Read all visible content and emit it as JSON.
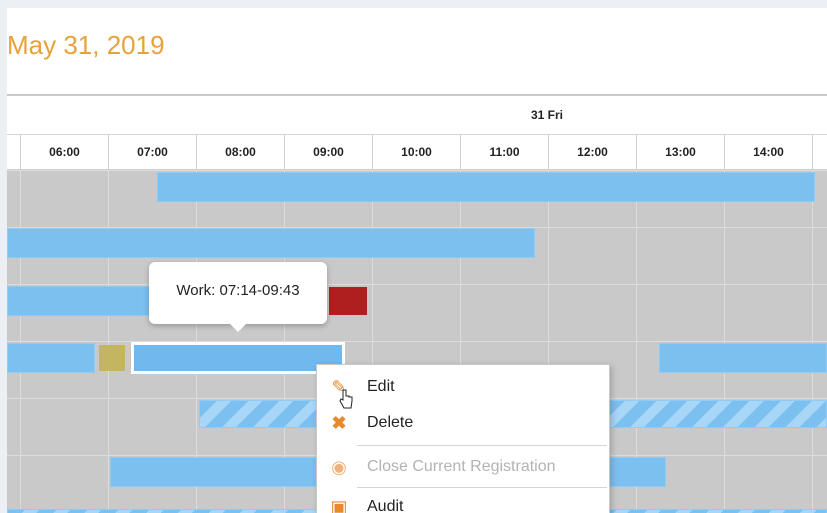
{
  "header": {
    "date_title": "May 31, 2019",
    "day_label": "31 Fri"
  },
  "hours": [
    "06:00",
    "07:00",
    "08:00",
    "09:00",
    "10:00",
    "11:00",
    "12:00",
    "13:00",
    "14:00"
  ],
  "tooltip": {
    "text": "Work: 07:14-09:43"
  },
  "context_menu": {
    "items": [
      {
        "label": "Edit",
        "icon": "edit-icon",
        "disabled": false
      },
      {
        "label": "Delete",
        "icon": "delete-icon",
        "disabled": false
      },
      {
        "label": "Close Current Registration",
        "icon": "close-registration-icon",
        "disabled": true
      },
      {
        "label": "Audit",
        "icon": "audit-icon",
        "disabled": false
      }
    ]
  },
  "colors": {
    "accent": "#e8a23a",
    "bar": "#7cc0f0",
    "alert_block": "#b01f1f",
    "marker_block": "#c4b560"
  }
}
